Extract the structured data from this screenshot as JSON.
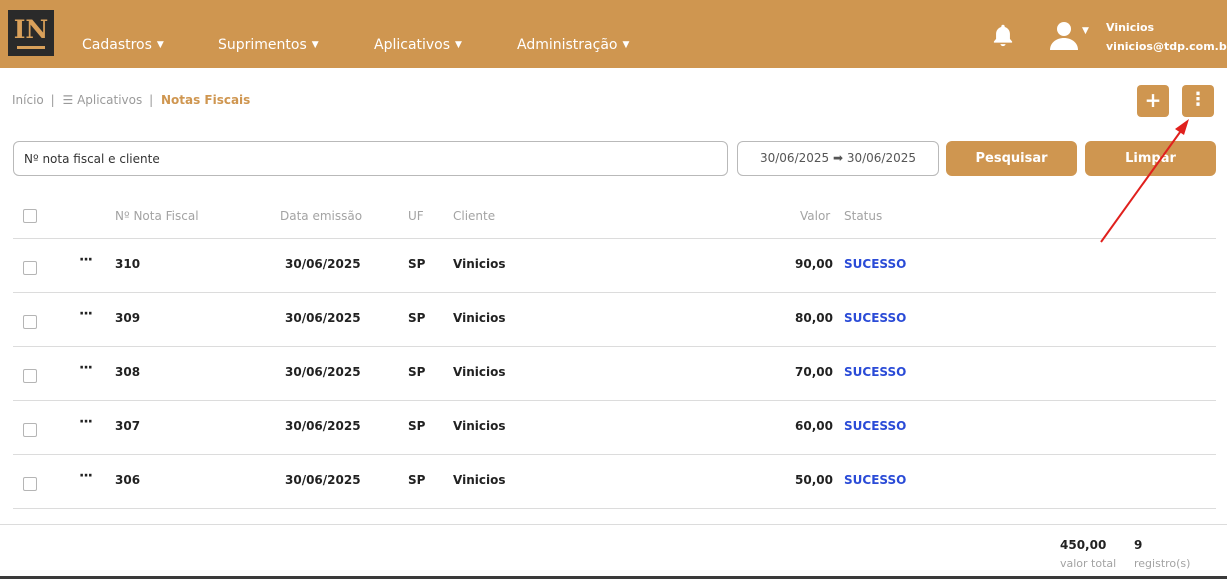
{
  "header": {
    "logo_text": "IN",
    "nav": [
      {
        "label": "Cadastros"
      },
      {
        "label": "Suprimentos"
      },
      {
        "label": "Aplicativos"
      },
      {
        "label": "Administração"
      }
    ],
    "user": {
      "name": "Vinicios",
      "email": "vinicios@tdp.com.br"
    },
    "icons": {
      "notifications": "bell-icon",
      "user": "user-icon",
      "dropdown": "caret-down-icon"
    }
  },
  "breadcrumb": {
    "home": "Início",
    "menu_icon": "☰",
    "apps": "Aplicativos",
    "current": "Notas Fiscais",
    "separator": "|"
  },
  "actions": {
    "add_label": "+",
    "more_label": "⋮",
    "add_icon": "plus-icon",
    "more_icon": "kebab-menu-icon"
  },
  "filters": {
    "search_placeholder": "Nº nota fiscal e cliente",
    "date_range": "30/06/2025 ➡ 30/06/2025",
    "search_button": "Pesquisar",
    "clear_button": "Limpar"
  },
  "table": {
    "columns": {
      "nota": "Nº Nota Fiscal",
      "data": "Data emissão",
      "uf": "UF",
      "cliente": "Cliente",
      "valor": "Valor",
      "status": "Status"
    },
    "row_menu_label": "···",
    "rows": [
      {
        "nota": "310",
        "data": "30/06/2025",
        "uf": "SP",
        "cliente": "Vinicios",
        "valor": "90,00",
        "status": "SUCESSO"
      },
      {
        "nota": "309",
        "data": "30/06/2025",
        "uf": "SP",
        "cliente": "Vinicios",
        "valor": "80,00",
        "status": "SUCESSO"
      },
      {
        "nota": "308",
        "data": "30/06/2025",
        "uf": "SP",
        "cliente": "Vinicios",
        "valor": "70,00",
        "status": "SUCESSO"
      },
      {
        "nota": "307",
        "data": "30/06/2025",
        "uf": "SP",
        "cliente": "Vinicios",
        "valor": "60,00",
        "status": "SUCESSO"
      },
      {
        "nota": "306",
        "data": "30/06/2025",
        "uf": "SP",
        "cliente": "Vinicios",
        "valor": "50,00",
        "status": "SUCESSO"
      }
    ]
  },
  "footer": {
    "total_value": "450,00",
    "total_value_label": "valor total",
    "record_count": "9",
    "record_count_label": "registro(s)"
  },
  "colors": {
    "brand": "#cf9650",
    "status_success": "#2a4bd7",
    "annotation": "#e0201d"
  }
}
